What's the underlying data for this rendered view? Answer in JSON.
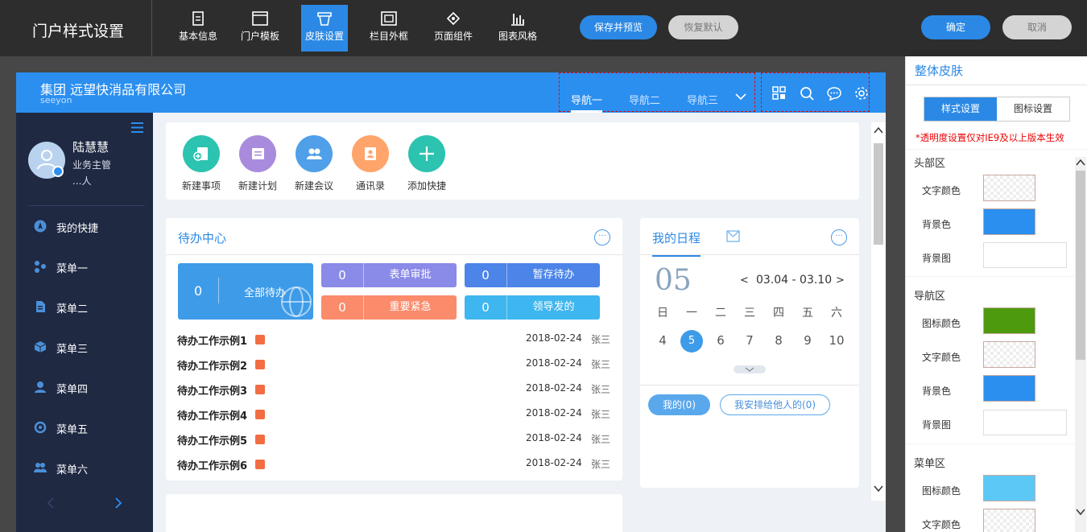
{
  "app": {
    "title": "门户样式设置"
  },
  "toolbar": {
    "items": [
      {
        "label": "基本信息",
        "icon": "doc-icon"
      },
      {
        "label": "门户模板",
        "icon": "window-icon"
      },
      {
        "label": "皮肤设置",
        "icon": "skin-icon",
        "active": true
      },
      {
        "label": "栏目外框",
        "icon": "frame-icon"
      },
      {
        "label": "页面组件",
        "icon": "component-icon"
      },
      {
        "label": "图表风格",
        "icon": "chart-icon"
      }
    ],
    "save_preview": "保存并预览",
    "restore": "恢复默认",
    "confirm": "确定",
    "cancel": "取消"
  },
  "preview": {
    "company": "集团 远望快消品有限公司",
    "company_sub": "seeyon",
    "nav": [
      "导航一",
      "导航二",
      "导航三"
    ],
    "user": {
      "name": "陆慧慧",
      "role": "业务主管",
      "org": "...人"
    },
    "menu": [
      "我的快捷",
      "菜单一",
      "菜单二",
      "菜单三",
      "菜单四",
      "菜单五",
      "菜单六"
    ],
    "quick": [
      "新建事项",
      "新建计划",
      "新建会议",
      "通讯录",
      "添加快捷"
    ],
    "todo": {
      "title": "待办中心",
      "all": {
        "n": "0",
        "label": "全部待办"
      },
      "stats": [
        {
          "n": "0",
          "label": "表单审批"
        },
        {
          "n": "0",
          "label": "暂存待办"
        },
        {
          "n": "0",
          "label": "重要紧急"
        },
        {
          "n": "0",
          "label": "领导发的"
        }
      ],
      "rows": [
        {
          "title": "待办工作示例1",
          "date": "2018-02-24",
          "person": "张三"
        },
        {
          "title": "待办工作示例2",
          "date": "2018-02-24",
          "person": "张三"
        },
        {
          "title": "待办工作示例3",
          "date": "2018-02-24",
          "person": "张三"
        },
        {
          "title": "待办工作示例4",
          "date": "2018-02-24",
          "person": "张三"
        },
        {
          "title": "待办工作示例5",
          "date": "2018-02-24",
          "person": "张三"
        },
        {
          "title": "待办工作示例6",
          "date": "2018-02-24",
          "person": "张三"
        }
      ]
    },
    "schedule": {
      "title": "我的日程",
      "day": "05",
      "range": "03.04 - 03.10",
      "prev": "<",
      "next": ">",
      "weekdays": [
        "日",
        "一",
        "二",
        "三",
        "四",
        "五",
        "六"
      ],
      "dates": [
        "4",
        "5",
        "6",
        "7",
        "8",
        "9",
        "10"
      ],
      "mine": "我的(0)",
      "others": "我安排给他人的(0)"
    },
    "todo_more": "···",
    "sched_more": "···"
  },
  "panel": {
    "title": "整体皮肤",
    "tab_style": "样式设置",
    "tab_icon": "图标设置",
    "warning": "*透明度设置仅对IE9及以上版本生效",
    "head": {
      "title": "头部区",
      "text_color": "文字颜色",
      "bg_color": "背景色",
      "bg_image": "背景图"
    },
    "nav": {
      "title": "导航区",
      "icon_color": "图标颜色",
      "text_color": "文字颜色",
      "bg_color": "背景色",
      "bg_image": "背景图"
    },
    "menu": {
      "title": "菜单区",
      "icon_color": "图标颜色",
      "text_color": "文字颜色"
    },
    "colors": {
      "head_bg": "#2b8ff0",
      "nav_icon": "#4d9a0f",
      "nav_bg": "#2b8ff0",
      "menu_icon": "#5cc8f5"
    }
  }
}
